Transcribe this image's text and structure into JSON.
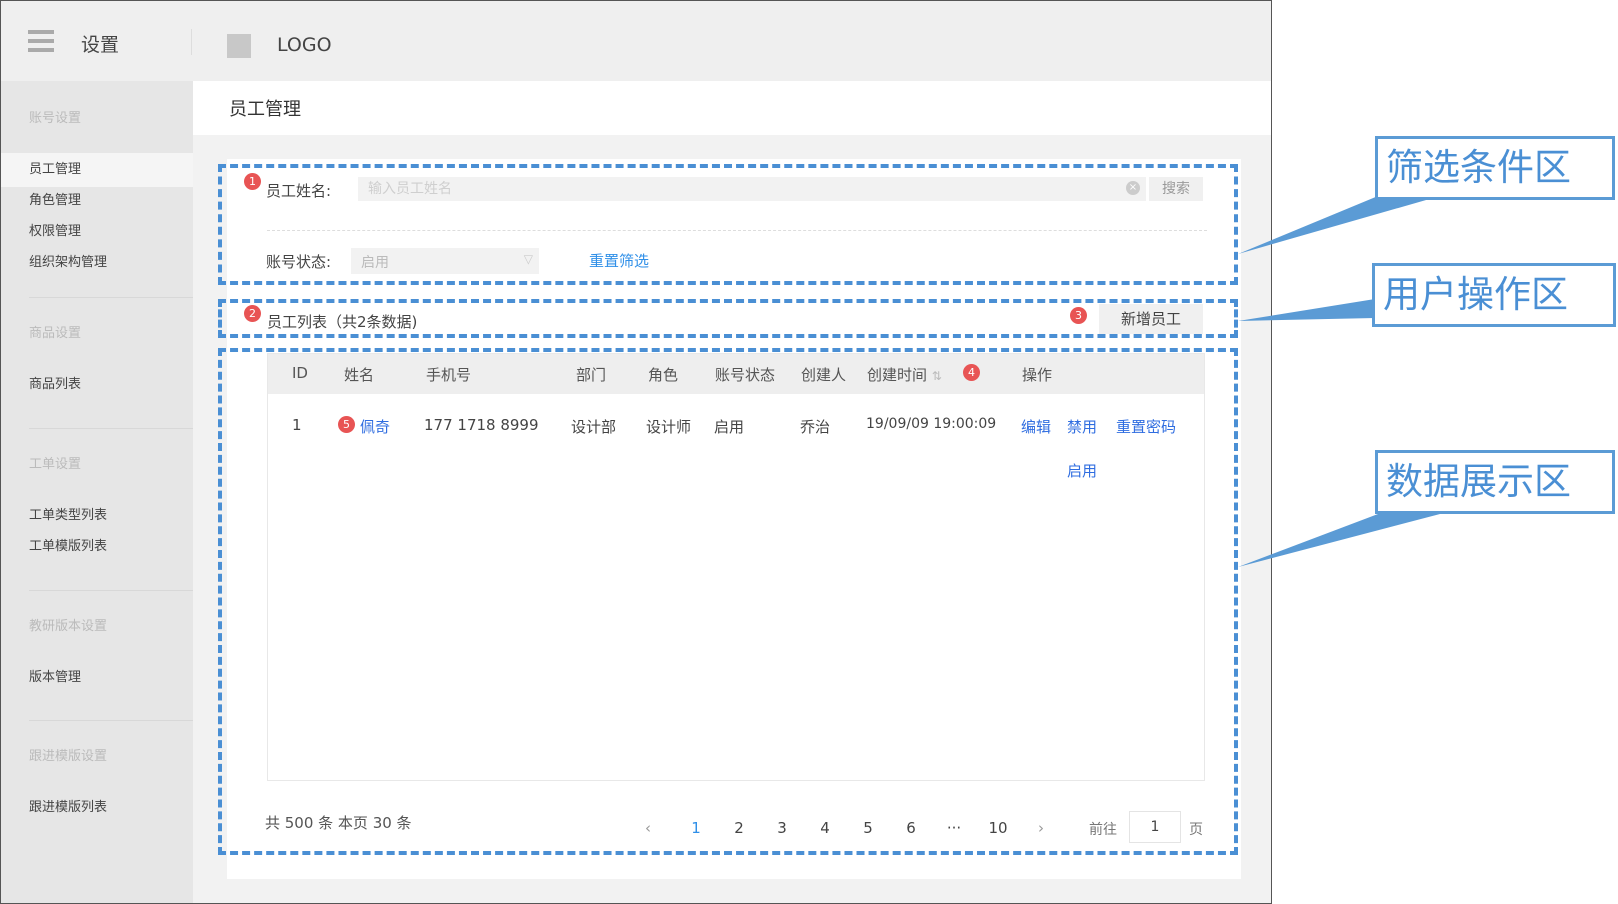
{
  "topbar": {
    "settings_title": "设置",
    "logo": "LOGO"
  },
  "sidebar": {
    "groups": [
      {
        "label": "账号设置",
        "items": [
          "员工管理",
          "角色管理",
          "权限管理",
          "组织架构管理"
        ]
      },
      {
        "label": "商品设置",
        "items": [
          "商品列表"
        ]
      },
      {
        "label": "工单设置",
        "items": [
          "工单类型列表",
          "工单模版列表"
        ]
      },
      {
        "label": "教研版本设置",
        "items": [
          "版本管理"
        ]
      },
      {
        "label": "跟进模版设置",
        "items": [
          "跟进模版列表"
        ]
      }
    ],
    "active_item": "员工管理"
  },
  "page": {
    "title": "员工管理"
  },
  "filter": {
    "name_label": "员工姓名:",
    "name_placeholder": "输入员工姓名",
    "search_label": "搜索",
    "status_label": "账号状态:",
    "status_value": "启用",
    "reset_label": "重置筛选"
  },
  "list": {
    "title": "员工列表（共2条数据)",
    "add_label": "新增员工"
  },
  "table": {
    "columns": [
      "ID",
      "姓名",
      "手机号",
      "部门",
      "角色",
      "账号状态",
      "创建人",
      "创建时间",
      "操作"
    ],
    "rows": [
      {
        "id": "1",
        "name": "佩奇",
        "phone": "177 1718 8999",
        "dept": "设计部",
        "role": "设计师",
        "status": "启用",
        "creator": "乔治",
        "created": "19/09/09 19:00:09",
        "actions": [
          "编辑",
          "禁用",
          "重置密码",
          "启用"
        ]
      }
    ]
  },
  "pagination": {
    "summary": "共 500 条  本页 30 条",
    "pages": [
      "1",
      "2",
      "3",
      "4",
      "5",
      "6",
      "···",
      "10"
    ],
    "current": "1",
    "goto_label": "前往",
    "goto_value": "1",
    "goto_unit": "页"
  },
  "annotations": {
    "badges": [
      "1",
      "2",
      "3",
      "4",
      "5"
    ],
    "callouts": [
      "筛选条件区",
      "用户操作区",
      "数据展示区"
    ],
    "zone_color": "#4a8fd4"
  }
}
